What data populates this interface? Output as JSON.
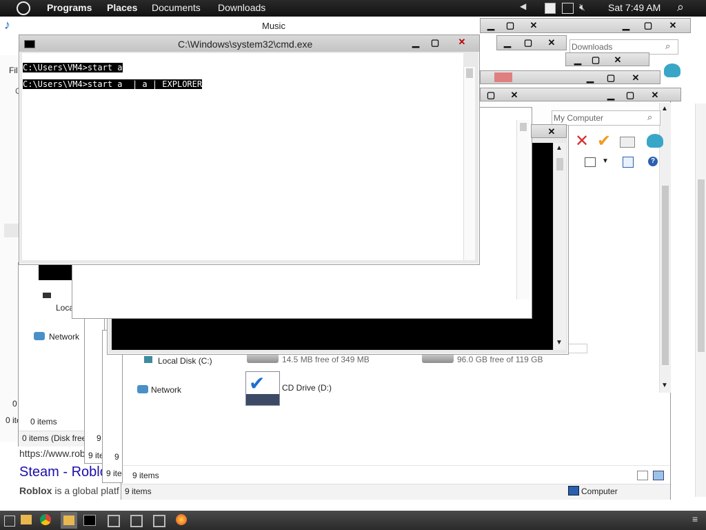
{
  "top_panel": {
    "programs": "Programs",
    "places": "Places",
    "documents": "Documents",
    "downloads": "Downloads",
    "clock": "Sat 7:49 AM"
  },
  "music_window": {
    "title": "Music"
  },
  "cmd_window": {
    "title": "C:\\Windows\\system32\\cmd.exe",
    "lines": [
      "C:\\Users\\VM4>start a",
      "C:\\Users\\VM4>start a  | a | EXPLORER"
    ]
  },
  "downloads_search": {
    "placeholder": "Downloads"
  },
  "computer_search": {
    "placeholder": "My Computer"
  },
  "explorer_main": {
    "local_disk_label": "Local Disk (C:)",
    "network_label": "Network",
    "drive1_free": "14.5 MB free of 349 MB",
    "drive2_free": "96.0 GB free of 119 GB",
    "cd_drive": "CD Drive (D:)",
    "status_items": "9 items",
    "status_computer": "Computer",
    "inner_status": "9 items"
  },
  "back_windows": {
    "local_label": "Loca",
    "network_label": "Network",
    "items0": "0 items",
    "items0_disk": "0 items (Disk free",
    "items9a": "9",
    "items9b": "9 ite",
    "items9c": "9",
    "items9d": "9 ite",
    "zero_left": "0",
    "zero_items_left": "0 ite",
    "fi_label": "Fil",
    "c_label": "C"
  },
  "browser_behind": {
    "url": "https://www.rob",
    "heading": "Steam - Roblo",
    "desc_bold": "Roblox",
    "desc_rest": " is a global platf"
  },
  "colors": {
    "panel": "#161616",
    "taskbar": "#3a3a3a",
    "link": "#1a0dab"
  }
}
